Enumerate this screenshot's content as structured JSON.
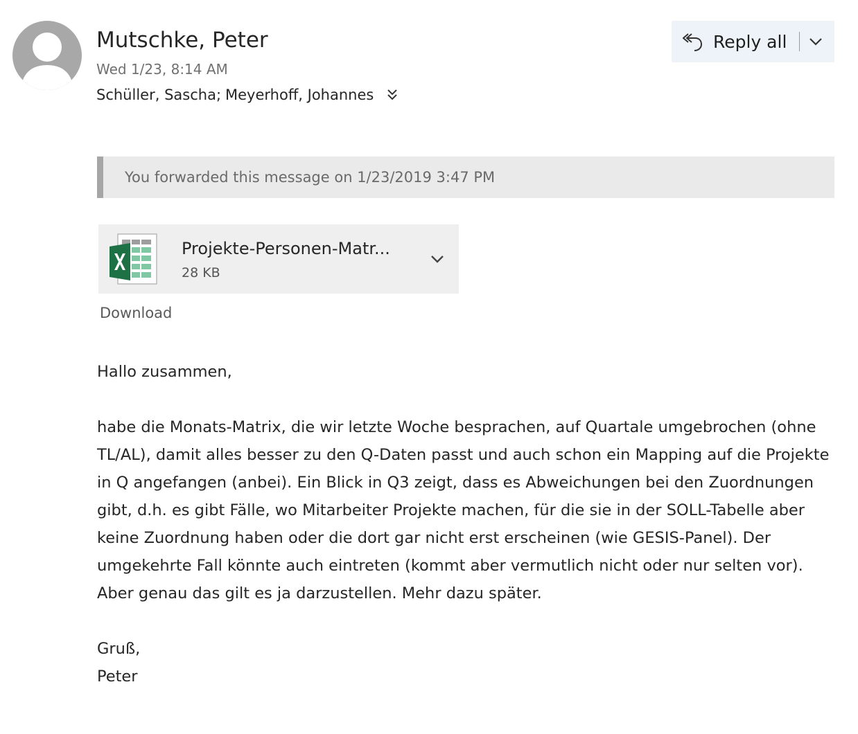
{
  "message": {
    "sender": "Mutschke, Peter",
    "sent": "Wed 1/23, 8:14 AM",
    "recipients": [
      "Schüller, Sascha",
      "Meyerhoff, Johannes"
    ],
    "recipient_separator": ";"
  },
  "actions": {
    "reply_all_label": "Reply all"
  },
  "notice": {
    "forwarded": "You forwarded this message on 1/23/2019 3:47 PM"
  },
  "attachment": {
    "file_name": "Projekte-Personen-Matr...",
    "file_size": "28 KB",
    "icon": "excel-icon",
    "download_label": "Download"
  },
  "body": {
    "greeting": "Hallo zusammen,",
    "paragraph": "habe die Monats-Matrix, die wir letzte Woche besprachen, auf Quartale umgebrochen (ohne TL/AL), damit alles besser zu den Q-Daten passt und auch schon ein Mapping auf die Projekte in Q angefangen (anbei). Ein Blick in Q3 zeigt, dass es Abweichungen bei den Zuordnungen gibt, d.h. es gibt Fälle, wo Mitarbeiter Projekte machen, für die sie in der SOLL-Tabelle aber keine Zuordnung haben oder die dort gar nicht erst erscheinen (wie GESIS-Panel). Der umgekehrte Fall könnte auch eintreten (kommt aber vermutlich nicht oder nur selten vor). Aber genau das gilt es ja darzustellen. Mehr dazu später.",
    "closing": "Gruß,",
    "signature": "Peter"
  },
  "colors": {
    "reply_button_bg": "#eef3f9",
    "notice_bg": "#eaeaea",
    "notice_bar": "#a6a6a6",
    "attachment_bg": "#efefef",
    "excel_green": "#1e7145"
  }
}
